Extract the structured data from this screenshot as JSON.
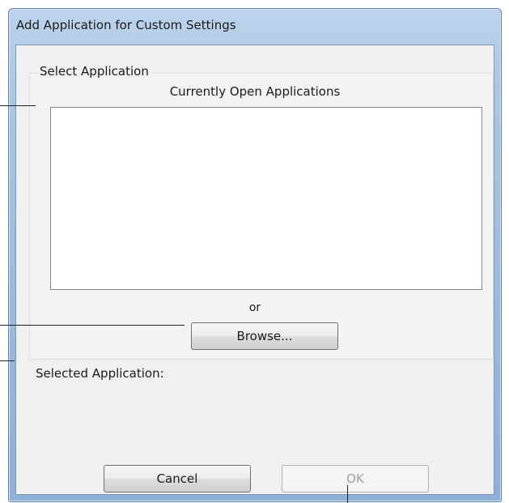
{
  "window": {
    "title": "Add Application for Custom Settings"
  },
  "select_application": {
    "group_label": "Select Application",
    "list_heading": "Currently Open Applications",
    "items": [],
    "or_text": "or",
    "browse_label": "Browse..."
  },
  "selected_application": {
    "label": "Selected Application:",
    "value": ""
  },
  "footer": {
    "cancel_label": "Cancel",
    "ok_label": "OK",
    "ok_enabled": false
  },
  "colors": {
    "frame_blue": "#9fbedf",
    "client_bg": "#f0f0f0",
    "disabled_text": "#a0a0a0"
  }
}
